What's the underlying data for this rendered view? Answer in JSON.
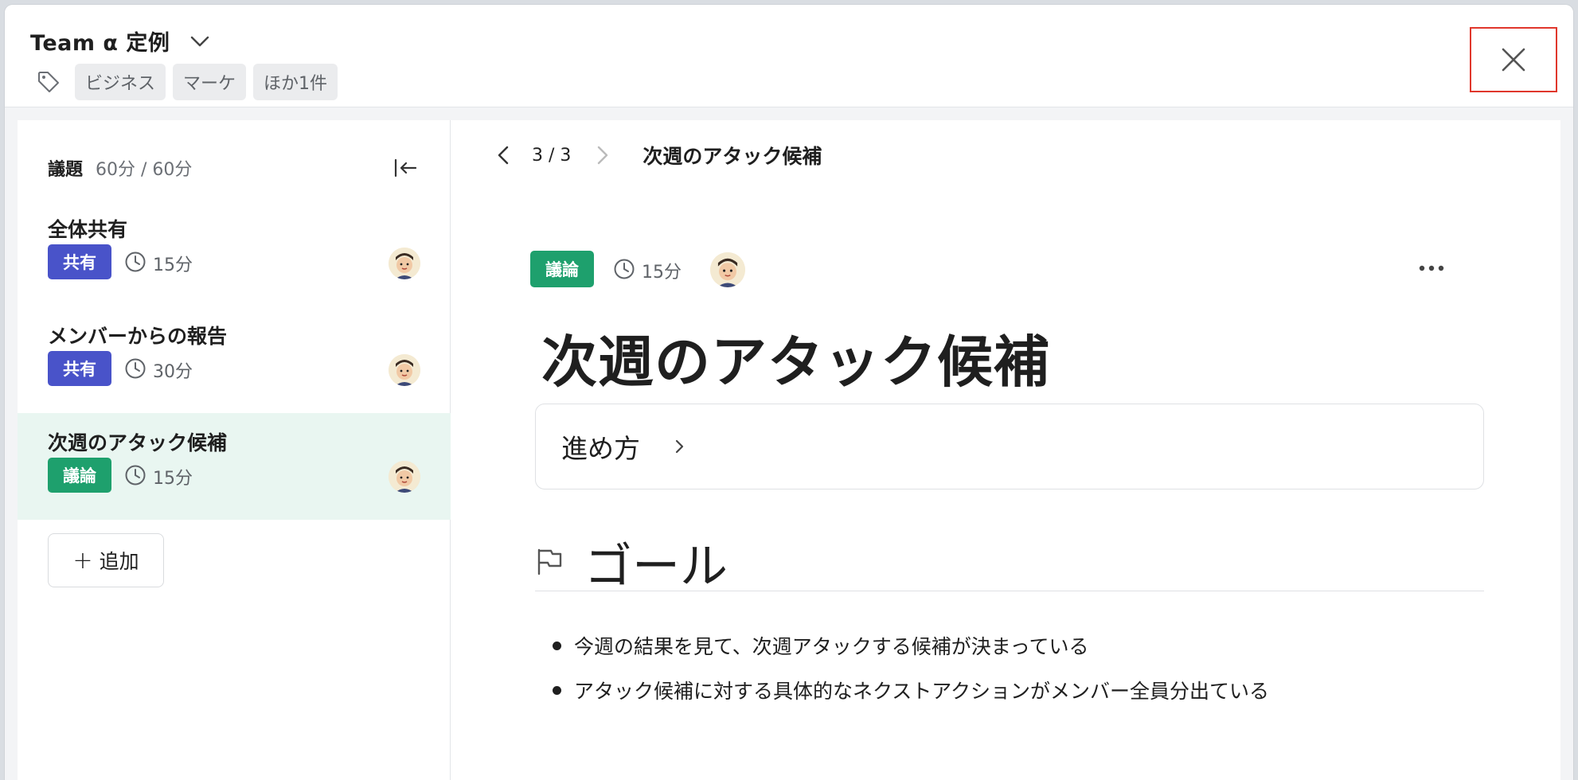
{
  "header": {
    "title": "Team α 定例",
    "tags": [
      "ビジネス",
      "マーケ",
      "ほか1件"
    ]
  },
  "sidebar": {
    "heading": "議題",
    "time_summary": "60分 / 60分",
    "items": [
      {
        "title": "全体共有",
        "badge": "共有",
        "duration": "15分"
      },
      {
        "title": "メンバーからの報告",
        "badge": "共有",
        "duration": "30分"
      },
      {
        "title": "次週のアタック候補",
        "badge": "議論",
        "duration": "15分"
      }
    ],
    "add_label": "追加"
  },
  "main": {
    "pager_text": "3 / 3",
    "pager_title": "次週のアタック候補",
    "badge": "議論",
    "duration": "15分",
    "title": "次週のアタック候補",
    "howto_label": "進め方",
    "goal_heading": "ゴール",
    "goal_bullets": [
      "今週の結果を見て、次週アタックする候補が決まっている",
      "アタック候補に対する具体的なネクストアクションがメンバー全員分出ている"
    ]
  },
  "colors": {
    "share_badge": "#4953c9",
    "discuss_badge": "#1ea06d",
    "selected_row": "#e9f6f1",
    "close_highlight": "#e0372c"
  }
}
